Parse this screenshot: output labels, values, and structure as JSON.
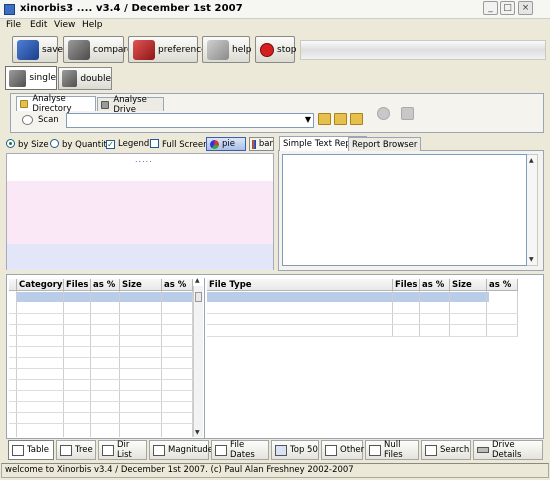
{
  "window": {
    "title": "xinorbis3 .... v3.4 / December 1st 2007"
  },
  "menu": [
    "File",
    "Edit",
    "View",
    "Help"
  ],
  "toolbar": {
    "save": "save",
    "compare": "compare",
    "preferences": "preferences",
    "help": "help",
    "stop": "stop"
  },
  "modes": {
    "single": "single",
    "double": "double"
  },
  "analyse_tabs": {
    "directory": "Analyse Directory",
    "drive": "Analyse Drive"
  },
  "scan": {
    "label": "Scan",
    "value": ""
  },
  "chart_options": {
    "by_size": "by Size",
    "by_quantity": "by Quantity",
    "legend": "Legend",
    "full_screen": "Full Screen",
    "pie": "pie",
    "bar": "bar",
    "selected": "by Size",
    "legend_checked": true,
    "full_screen_checked": false,
    "dots": "....."
  },
  "report_tabs": {
    "simple": "Simple Text Report",
    "browser": "Report Browser"
  },
  "left_table": {
    "headers": [
      "Category",
      "Files",
      "as %",
      "Size",
      "as %"
    ]
  },
  "right_table": {
    "headers": [
      "File Type",
      "Files",
      "as %",
      "Size",
      "as %"
    ]
  },
  "bottom_tabs": [
    "Table",
    "Tree",
    "Dir List",
    "Magnitude",
    "File Dates",
    "Top 50",
    "Other",
    "Null Files",
    "Search",
    "Drive Details"
  ],
  "status": "welcome to Xinorbis v3.4 / December 1st 2007. (c) Paul Alan Freshney 2002-2007",
  "colors": {
    "pink_band": "#fbe8f6",
    "blue_band": "#e3e6f8",
    "selection": "#b9cce8"
  }
}
